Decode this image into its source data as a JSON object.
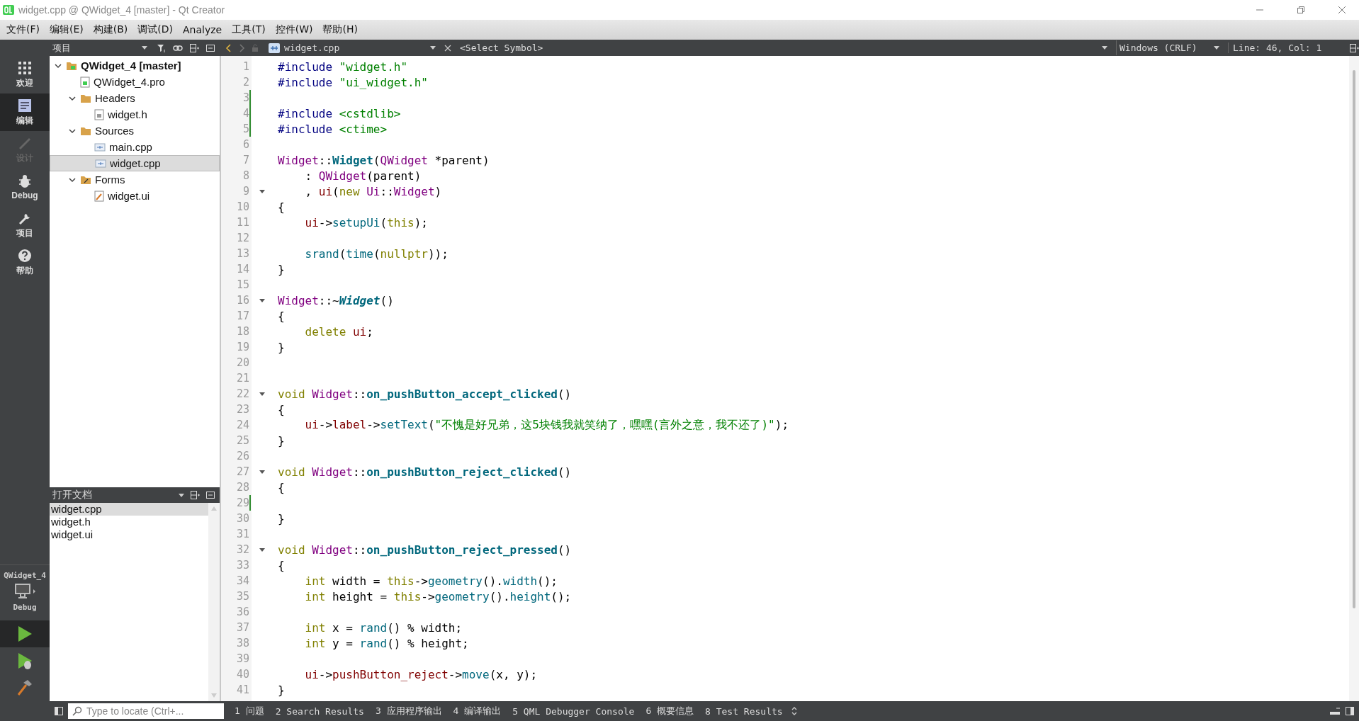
{
  "window": {
    "title": "widget.cpp @ QWidget_4 [master] - Qt Creator"
  },
  "menu_bar": [
    "文件(F)",
    "编辑(E)",
    "构建(B)",
    "调试(D)",
    "Analyze",
    "工具(T)",
    "控件(W)",
    "帮助(H)"
  ],
  "mode_bar": {
    "modes": [
      {
        "label": "欢迎",
        "kind": "welcome",
        "selected": false,
        "disabled": false
      },
      {
        "label": "编辑",
        "kind": "edit",
        "selected": true,
        "disabled": false
      },
      {
        "label": "设计",
        "kind": "design",
        "selected": false,
        "disabled": true
      },
      {
        "label": "Debug",
        "kind": "debug",
        "selected": false,
        "disabled": false
      },
      {
        "label": "项目",
        "kind": "projects",
        "selected": false,
        "disabled": false
      },
      {
        "label": "帮助",
        "kind": "help",
        "selected": false,
        "disabled": false
      }
    ],
    "kit": {
      "project": "QWidget_4",
      "build": "Debug"
    }
  },
  "toolbar": {
    "panel_title": "项目",
    "file": "widget.cpp",
    "symbol": "<Select Symbol>",
    "line_ending": "Windows (CRLF)",
    "position": "Line: 46, Col: 1"
  },
  "project_tree": {
    "items": [
      {
        "label": "QWidget_4 [master]",
        "kind": "project",
        "expanded": true,
        "selected": false,
        "children": [
          {
            "label": "QWidget_4.pro",
            "kind": "pro",
            "selected": false
          },
          {
            "label": "Headers",
            "kind": "folder-h",
            "expanded": true,
            "selected": false,
            "children": [
              {
                "label": "widget.h",
                "kind": "header",
                "selected": false
              }
            ]
          },
          {
            "label": "Sources",
            "kind": "folder-cpp",
            "expanded": true,
            "selected": false,
            "children": [
              {
                "label": "main.cpp",
                "kind": "source",
                "selected": false
              },
              {
                "label": "widget.cpp",
                "kind": "source",
                "selected": true
              }
            ]
          },
          {
            "label": "Forms",
            "kind": "folder-ui",
            "expanded": true,
            "selected": false,
            "children": [
              {
                "label": "widget.ui",
                "kind": "form",
                "selected": false
              }
            ]
          }
        ]
      }
    ]
  },
  "open_documents": {
    "title": "打开文档",
    "items": [
      {
        "label": "widget.cpp",
        "selected": true
      },
      {
        "label": "widget.h",
        "selected": false
      },
      {
        "label": "widget.ui",
        "selected": false
      }
    ]
  },
  "editor": {
    "lines": [
      {
        "number": "1",
        "foldable": false,
        "modified": false,
        "tokens": [
          {
            "text": "#include ",
            "kind": "pp"
          },
          {
            "text": "\"widget.h\"",
            "kind": "str"
          }
        ]
      },
      {
        "number": "2",
        "foldable": false,
        "modified": false,
        "tokens": [
          {
            "text": "#include ",
            "kind": "pp"
          },
          {
            "text": "\"ui_widget.h\"",
            "kind": "str"
          }
        ]
      },
      {
        "number": "3",
        "foldable": false,
        "modified": true
      },
      {
        "number": "4",
        "foldable": false,
        "modified": true,
        "tokens": [
          {
            "text": "#include ",
            "kind": "pp"
          },
          {
            "text": "<cstdlib>",
            "kind": "str"
          }
        ]
      },
      {
        "number": "5",
        "foldable": false,
        "modified": true,
        "tokens": [
          {
            "text": "#include ",
            "kind": "pp"
          },
          {
            "text": "<ctime>",
            "kind": "str"
          }
        ]
      },
      {
        "number": "6",
        "foldable": false,
        "modified": false
      },
      {
        "number": "7",
        "foldable": false,
        "modified": false,
        "tokens": [
          {
            "text": "Widget",
            "kind": "cls"
          },
          {
            "text": "::",
            "kind": "plain"
          },
          {
            "text": "Widget",
            "kind": "decl"
          },
          {
            "text": "(",
            "kind": "plain"
          },
          {
            "text": "QWidget",
            "kind": "cls"
          },
          {
            "text": " *parent)",
            "kind": "plain"
          }
        ]
      },
      {
        "number": "8",
        "foldable": false,
        "modified": false,
        "tokens": [
          {
            "text": "    : ",
            "kind": "plain"
          },
          {
            "text": "QWidget",
            "kind": "cls"
          },
          {
            "text": "(parent)",
            "kind": "plain"
          }
        ]
      },
      {
        "number": "9",
        "foldable": true,
        "modified": false,
        "tokens": [
          {
            "text": "    , ",
            "kind": "plain"
          },
          {
            "text": "ui",
            "kind": "member"
          },
          {
            "text": "(",
            "kind": "plain"
          },
          {
            "text": "new ",
            "kind": "kw"
          },
          {
            "text": "Ui",
            "kind": "cls"
          },
          {
            "text": "::",
            "kind": "plain"
          },
          {
            "text": "Widget",
            "kind": "cls"
          },
          {
            "text": ")",
            "kind": "plain"
          }
        ]
      },
      {
        "number": "10",
        "foldable": false,
        "modified": false,
        "tokens": [
          {
            "text": "{",
            "kind": "plain"
          }
        ]
      },
      {
        "number": "11",
        "foldable": false,
        "modified": false,
        "tokens": [
          {
            "text": "    ui",
            "kind": "member"
          },
          {
            "text": "->",
            "kind": "plain"
          },
          {
            "text": "setupUi",
            "kind": "fn"
          },
          {
            "text": "(",
            "kind": "plain"
          },
          {
            "text": "this",
            "kind": "kw"
          },
          {
            "text": ");",
            "kind": "plain"
          }
        ]
      },
      {
        "number": "12",
        "foldable": false,
        "modified": false
      },
      {
        "number": "13",
        "foldable": false,
        "modified": false,
        "tokens": [
          {
            "text": "    srand",
            "kind": "fn"
          },
          {
            "text": "(",
            "kind": "plain"
          },
          {
            "text": "time",
            "kind": "fn"
          },
          {
            "text": "(",
            "kind": "plain"
          },
          {
            "text": "nullptr",
            "kind": "kw"
          },
          {
            "text": "));",
            "kind": "plain"
          }
        ]
      },
      {
        "number": "14",
        "foldable": false,
        "modified": false,
        "tokens": [
          {
            "text": "}",
            "kind": "plain"
          }
        ]
      },
      {
        "number": "15",
        "foldable": false,
        "modified": false
      },
      {
        "number": "16",
        "foldable": true,
        "modified": false,
        "tokens": [
          {
            "text": "Widget",
            "kind": "cls"
          },
          {
            "text": "::~",
            "kind": "plain"
          },
          {
            "text": "Widget",
            "kind": "decl-italic"
          },
          {
            "text": "()",
            "kind": "plain"
          }
        ]
      },
      {
        "number": "17",
        "foldable": false,
        "modified": false,
        "tokens": [
          {
            "text": "{",
            "kind": "plain"
          }
        ]
      },
      {
        "number": "18",
        "foldable": false,
        "modified": false,
        "tokens": [
          {
            "text": "    delete ",
            "kind": "kw"
          },
          {
            "text": "ui",
            "kind": "member"
          },
          {
            "text": ";",
            "kind": "plain"
          }
        ]
      },
      {
        "number": "19",
        "foldable": false,
        "modified": false,
        "tokens": [
          {
            "text": "}",
            "kind": "plain"
          }
        ]
      },
      {
        "number": "20",
        "foldable": false,
        "modified": false
      },
      {
        "number": "21",
        "foldable": false,
        "modified": false
      },
      {
        "number": "22",
        "foldable": true,
        "modified": false,
        "tokens": [
          {
            "text": "void ",
            "kind": "kw"
          },
          {
            "text": "Widget",
            "kind": "cls"
          },
          {
            "text": "::",
            "kind": "plain"
          },
          {
            "text": "on_pushButton_accept_clicked",
            "kind": "decl"
          },
          {
            "text": "()",
            "kind": "plain"
          }
        ]
      },
      {
        "number": "23",
        "foldable": false,
        "modified": false,
        "tokens": [
          {
            "text": "{",
            "kind": "plain"
          }
        ]
      },
      {
        "number": "24",
        "foldable": false,
        "modified": false,
        "tokens": [
          {
            "text": "    ui",
            "kind": "member"
          },
          {
            "text": "->",
            "kind": "plain"
          },
          {
            "text": "label",
            "kind": "member"
          },
          {
            "text": "->",
            "kind": "plain"
          },
          {
            "text": "setText",
            "kind": "fn"
          },
          {
            "text": "(",
            "kind": "plain"
          },
          {
            "text": "\"不愧是好兄弟，这5块钱我就笑纳了，嘿嘿(言外之意，我不还了)\"",
            "kind": "str"
          },
          {
            "text": ");",
            "kind": "plain"
          }
        ]
      },
      {
        "number": "25",
        "foldable": false,
        "modified": false,
        "tokens": [
          {
            "text": "}",
            "kind": "plain"
          }
        ]
      },
      {
        "number": "26",
        "foldable": false,
        "modified": false
      },
      {
        "number": "27",
        "foldable": true,
        "modified": false,
        "tokens": [
          {
            "text": "void ",
            "kind": "kw"
          },
          {
            "text": "Widget",
            "kind": "cls"
          },
          {
            "text": "::",
            "kind": "plain"
          },
          {
            "text": "on_pushButton_reject_clicked",
            "kind": "decl"
          },
          {
            "text": "()",
            "kind": "plain"
          }
        ]
      },
      {
        "number": "28",
        "foldable": false,
        "modified": false,
        "tokens": [
          {
            "text": "{",
            "kind": "plain"
          }
        ]
      },
      {
        "number": "29",
        "foldable": false,
        "modified": true
      },
      {
        "number": "30",
        "foldable": false,
        "modified": false,
        "tokens": [
          {
            "text": "}",
            "kind": "plain"
          }
        ]
      },
      {
        "number": "31",
        "foldable": false,
        "modified": false
      },
      {
        "number": "32",
        "foldable": true,
        "modified": false,
        "tokens": [
          {
            "text": "void ",
            "kind": "kw"
          },
          {
            "text": "Widget",
            "kind": "cls"
          },
          {
            "text": "::",
            "kind": "plain"
          },
          {
            "text": "on_pushButton_reject_pressed",
            "kind": "decl"
          },
          {
            "text": "()",
            "kind": "plain"
          }
        ]
      },
      {
        "number": "33",
        "foldable": false,
        "modified": false,
        "tokens": [
          {
            "text": "{",
            "kind": "plain"
          }
        ]
      },
      {
        "number": "34",
        "foldable": false,
        "modified": false,
        "tokens": [
          {
            "text": "    int",
            "kind": "kw"
          },
          {
            "text": " width = ",
            "kind": "plain"
          },
          {
            "text": "this",
            "kind": "kw"
          },
          {
            "text": "->",
            "kind": "plain"
          },
          {
            "text": "geometry",
            "kind": "fn"
          },
          {
            "text": "().",
            "kind": "plain"
          },
          {
            "text": "width",
            "kind": "fn"
          },
          {
            "text": "();",
            "kind": "plain"
          }
        ]
      },
      {
        "number": "35",
        "foldable": false,
        "modified": false,
        "tokens": [
          {
            "text": "    int",
            "kind": "kw"
          },
          {
            "text": " height = ",
            "kind": "plain"
          },
          {
            "text": "this",
            "kind": "kw"
          },
          {
            "text": "->",
            "kind": "plain"
          },
          {
            "text": "geometry",
            "kind": "fn"
          },
          {
            "text": "().",
            "kind": "plain"
          },
          {
            "text": "height",
            "kind": "fn"
          },
          {
            "text": "();",
            "kind": "plain"
          }
        ]
      },
      {
        "number": "36",
        "foldable": false,
        "modified": false
      },
      {
        "number": "37",
        "foldable": false,
        "modified": false,
        "tokens": [
          {
            "text": "    int",
            "kind": "kw"
          },
          {
            "text": " x = ",
            "kind": "plain"
          },
          {
            "text": "rand",
            "kind": "fn"
          },
          {
            "text": "() % width;",
            "kind": "plain"
          }
        ]
      },
      {
        "number": "38",
        "foldable": false,
        "modified": false,
        "tokens": [
          {
            "text": "    int",
            "kind": "kw"
          },
          {
            "text": " y = ",
            "kind": "plain"
          },
          {
            "text": "rand",
            "kind": "fn"
          },
          {
            "text": "() % height;",
            "kind": "plain"
          }
        ]
      },
      {
        "number": "39",
        "foldable": false,
        "modified": false
      },
      {
        "number": "40",
        "foldable": false,
        "modified": false,
        "tokens": [
          {
            "text": "    ui",
            "kind": "member"
          },
          {
            "text": "->",
            "kind": "plain"
          },
          {
            "text": "pushButton_reject",
            "kind": "member"
          },
          {
            "text": "->",
            "kind": "plain"
          },
          {
            "text": "move",
            "kind": "fn"
          },
          {
            "text": "(x, y);",
            "kind": "plain"
          }
        ]
      },
      {
        "number": "41",
        "foldable": false,
        "modified": false,
        "tokens": [
          {
            "text": "}",
            "kind": "plain"
          }
        ]
      }
    ]
  },
  "status_bar": {
    "locator_placeholder": "Type to locate (Ctrl+...",
    "panes": [
      "1 问题",
      "2 Search Results",
      "3 应用程序输出",
      "4 编译输出",
      "5 QML Debugger Console",
      "6 概要信息",
      "8 Test Results"
    ]
  }
}
